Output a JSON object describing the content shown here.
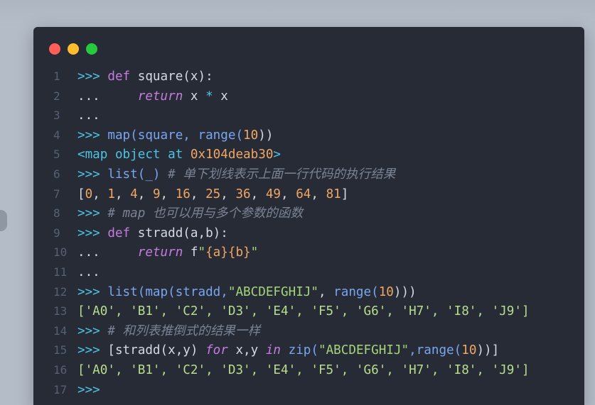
{
  "colors": {
    "page_background": "#b4bcc8",
    "editor_background": "#262b35",
    "close_dot": "#ff5f56",
    "minimize_dot": "#ffbd2e",
    "maximize_dot": "#27c93f",
    "prompt": "#4ec3e3",
    "keyword": "#c57be0",
    "number": "#f2a663",
    "string": "#a6d47a",
    "comment": "#7b8494",
    "line_number": "#566074"
  },
  "window": {
    "controls": [
      "close",
      "minimize",
      "maximize"
    ]
  },
  "code": {
    "lines": [
      {
        "n": "1",
        "t": [
          ">>> ",
          "def",
          " square(x):"
        ]
      },
      {
        "n": "2",
        "t": [
          "...     ",
          "return",
          " x ",
          "*",
          " x"
        ]
      },
      {
        "n": "3",
        "t": [
          "..."
        ]
      },
      {
        "n": "4",
        "t": [
          ">>> ",
          "map(square, ",
          "range(",
          "10",
          "))"
        ]
      },
      {
        "n": "5",
        "t": [
          "<map object at ",
          "0x104deab30",
          ">"
        ]
      },
      {
        "n": "6",
        "t": [
          ">>> ",
          "list(_) ",
          "# 单下划线表示上面一行代码的执行结果"
        ]
      },
      {
        "n": "7",
        "t": [
          "[",
          "0",
          ", ",
          "1",
          ", ",
          "4",
          ", ",
          "9",
          ", ",
          "16",
          ", ",
          "25",
          ", ",
          "36",
          ", ",
          "49",
          ", ",
          "64",
          ", ",
          "81",
          "]"
        ]
      },
      {
        "n": "8",
        "t": [
          ">>> ",
          "# map 也可以用与多个参数的函数"
        ]
      },
      {
        "n": "9",
        "t": [
          ">>> ",
          "def",
          " stradd(a,b):"
        ]
      },
      {
        "n": "10",
        "t": [
          "...     ",
          "return",
          " f",
          "\"",
          "{a}{b}",
          "\""
        ]
      },
      {
        "n": "11",
        "t": [
          "..."
        ]
      },
      {
        "n": "12",
        "t": [
          ">>> ",
          "list(map(stradd,",
          "\"ABCDEFGHIJ\"",
          ", ",
          "range(",
          "10",
          ")))"
        ]
      },
      {
        "n": "13",
        "t": [
          "['A0', 'B1', 'C2', 'D3', 'E4', 'F5', 'G6', 'H7', 'I8', 'J9']"
        ]
      },
      {
        "n": "14",
        "t": [
          ">>> ",
          "# 和列表推倒式的结果一样"
        ]
      },
      {
        "n": "15",
        "t": [
          ">>> ",
          "[stradd(x,y) ",
          "for",
          " x,y ",
          "in",
          " zip(",
          "\"ABCDEFGHIJ\"",
          ",range(",
          "10",
          "))]"
        ]
      },
      {
        "n": "16",
        "t": [
          "['A0', 'B1', 'C2', 'D3', 'E4', 'F5', 'G6', 'H7', 'I8', 'J9']"
        ]
      },
      {
        "n": "17",
        "t": [
          ">>>"
        ]
      }
    ]
  }
}
